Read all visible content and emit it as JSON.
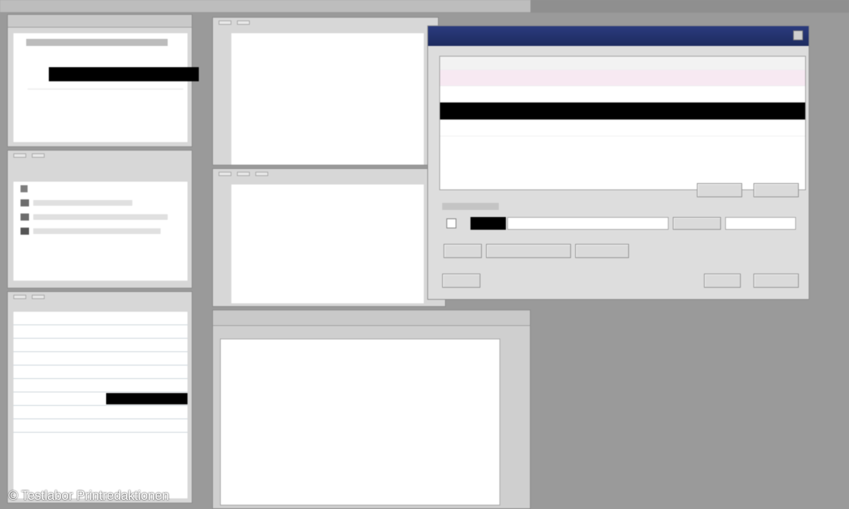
{
  "watermark": {
    "text": "© Testlabor Printredaktionen"
  }
}
